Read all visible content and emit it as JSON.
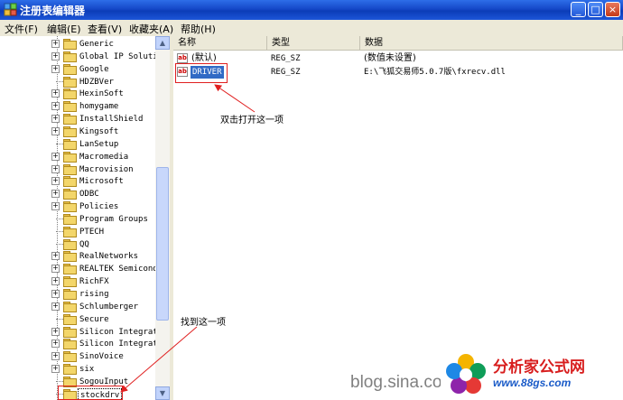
{
  "window": {
    "title": "注册表编辑器",
    "minimize": "_",
    "maximize": "□",
    "close": "×"
  },
  "menu": [
    "文件(F)",
    "编辑(E)",
    "查看(V)",
    "收藏夹(A)",
    "帮助(H)"
  ],
  "tree": {
    "items": [
      {
        "label": "Generic",
        "expandable": true
      },
      {
        "label": "Global IP Soluti",
        "expandable": true
      },
      {
        "label": "Google",
        "expandable": true
      },
      {
        "label": "HDZBVer",
        "expandable": false
      },
      {
        "label": "HexinSoft",
        "expandable": true
      },
      {
        "label": "homygame",
        "expandable": true
      },
      {
        "label": "InstallShield",
        "expandable": true
      },
      {
        "label": "Kingsoft",
        "expandable": true
      },
      {
        "label": "LanSetup",
        "expandable": false
      },
      {
        "label": "Macromedia",
        "expandable": true
      },
      {
        "label": "Macrovision",
        "expandable": true
      },
      {
        "label": "Microsoft",
        "expandable": true
      },
      {
        "label": "ODBC",
        "expandable": true
      },
      {
        "label": "Policies",
        "expandable": true
      },
      {
        "label": "Program Groups",
        "expandable": false
      },
      {
        "label": "PTECH",
        "expandable": false
      },
      {
        "label": "QQ",
        "expandable": false
      },
      {
        "label": "RealNetworks",
        "expandable": true
      },
      {
        "label": "REALTEK Semicond",
        "expandable": true
      },
      {
        "label": "RichFX",
        "expandable": true
      },
      {
        "label": "rising",
        "expandable": true
      },
      {
        "label": "Schlumberger",
        "expandable": true
      },
      {
        "label": "Secure",
        "expandable": false
      },
      {
        "label": "Silicon Integrat",
        "expandable": true
      },
      {
        "label": "Silicon Integrat",
        "expandable": true
      },
      {
        "label": "SinoVoice",
        "expandable": true
      },
      {
        "label": "six",
        "expandable": true
      },
      {
        "label": "SogouInput",
        "expandable": false
      },
      {
        "label": "stockdrv",
        "expandable": false,
        "selected": true
      }
    ],
    "scroll_up": "▲",
    "scroll_down": "▼"
  },
  "list": {
    "columns": [
      "名称",
      "类型",
      "数据"
    ],
    "rows": [
      {
        "icon": "ab",
        "name": "(默认)",
        "type": "REG_SZ",
        "data": "(数值未设置)"
      },
      {
        "icon": "ab",
        "name": "DRIVER",
        "type": "REG_SZ",
        "data": "E:\\飞狐交易师5.0.7版\\fxrecv.dll",
        "selected": true
      }
    ]
  },
  "annotations": {
    "double_click": "双击打开这一项",
    "find_this": "找到这一项"
  },
  "watermark": "blog.sina.com",
  "logo": {
    "name": "分析家公式网",
    "url": "www.88gs.com"
  },
  "colors": {
    "titlebar": "#1548c8",
    "selection": "#316ac5",
    "annotation": "#e02020",
    "logo_red": "#d81e1e",
    "logo_blue": "#1a5bc8"
  }
}
